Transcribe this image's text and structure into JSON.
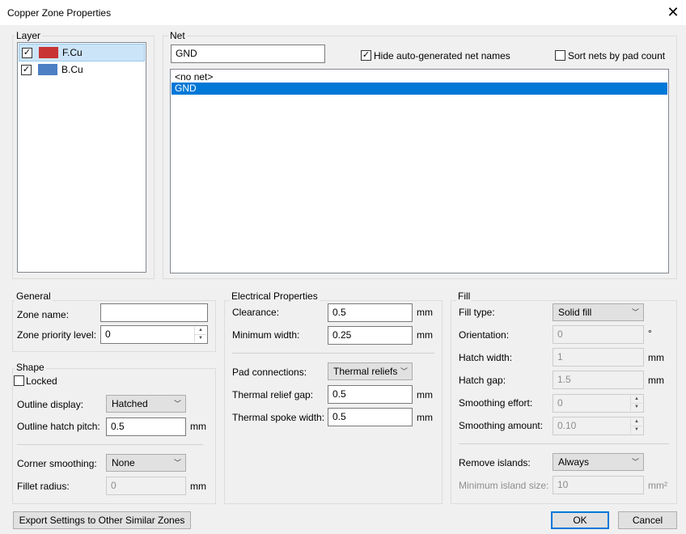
{
  "window": {
    "title": "Copper Zone Properties"
  },
  "layer": {
    "label": "Layer",
    "items": [
      {
        "name": "F.Cu",
        "checked": true,
        "color": "#c83434"
      },
      {
        "name": "B.Cu",
        "checked": true,
        "color": "#4d7fc4"
      }
    ]
  },
  "net": {
    "label": "Net",
    "filter_value": "GND",
    "hide_auto_label": "Hide auto-generated net names",
    "hide_auto_checked": true,
    "sort_label": "Sort nets by pad count",
    "sort_checked": false,
    "list": [
      "<no net>",
      "GND"
    ],
    "selected": "GND"
  },
  "general": {
    "label": "General",
    "zone_name_label": "Zone name:",
    "zone_name_value": "",
    "priority_label": "Zone priority level:",
    "priority_value": "0"
  },
  "shape": {
    "label": "Shape",
    "locked_label": "Locked",
    "outline_display_label": "Outline display:",
    "outline_display_value": "Hatched",
    "hatch_pitch_label": "Outline hatch pitch:",
    "hatch_pitch_value": "0.5",
    "hatch_pitch_unit": "mm",
    "corner_smoothing_label": "Corner smoothing:",
    "corner_smoothing_value": "None",
    "fillet_radius_label": "Fillet radius:",
    "fillet_radius_value": "0",
    "fillet_radius_unit": "mm"
  },
  "electrical": {
    "label": "Electrical Properties",
    "clearance_label": "Clearance:",
    "clearance_value": "0.5",
    "clearance_unit": "mm",
    "min_width_label": "Minimum width:",
    "min_width_value": "0.25",
    "min_width_unit": "mm",
    "pad_conn_label": "Pad connections:",
    "pad_conn_value": "Thermal reliefs",
    "relief_gap_label": "Thermal relief gap:",
    "relief_gap_value": "0.5",
    "relief_gap_unit": "mm",
    "spoke_width_label": "Thermal spoke width:",
    "spoke_width_value": "0.5",
    "spoke_width_unit": "mm"
  },
  "fill": {
    "label": "Fill",
    "type_label": "Fill type:",
    "type_value": "Solid fill",
    "orientation_label": "Orientation:",
    "orientation_value": "0",
    "orientation_unit": "°",
    "hatch_width_label": "Hatch width:",
    "hatch_width_value": "1",
    "hatch_width_unit": "mm",
    "hatch_gap_label": "Hatch gap:",
    "hatch_gap_value": "1.5",
    "hatch_gap_unit": "mm",
    "smooth_effort_label": "Smoothing effort:",
    "smooth_effort_value": "0",
    "smooth_amount_label": "Smoothing amount:",
    "smooth_amount_value": "0.10",
    "remove_islands_label": "Remove islands:",
    "remove_islands_value": "Always",
    "min_island_label": "Minimum island size:",
    "min_island_value": "10",
    "min_island_unit": "mm²"
  },
  "buttons": {
    "export": "Export Settings to Other Similar Zones",
    "ok": "OK",
    "cancel": "Cancel"
  },
  "colors": {
    "selection": "#0078d7",
    "row_highlight": "#cce4f7"
  }
}
